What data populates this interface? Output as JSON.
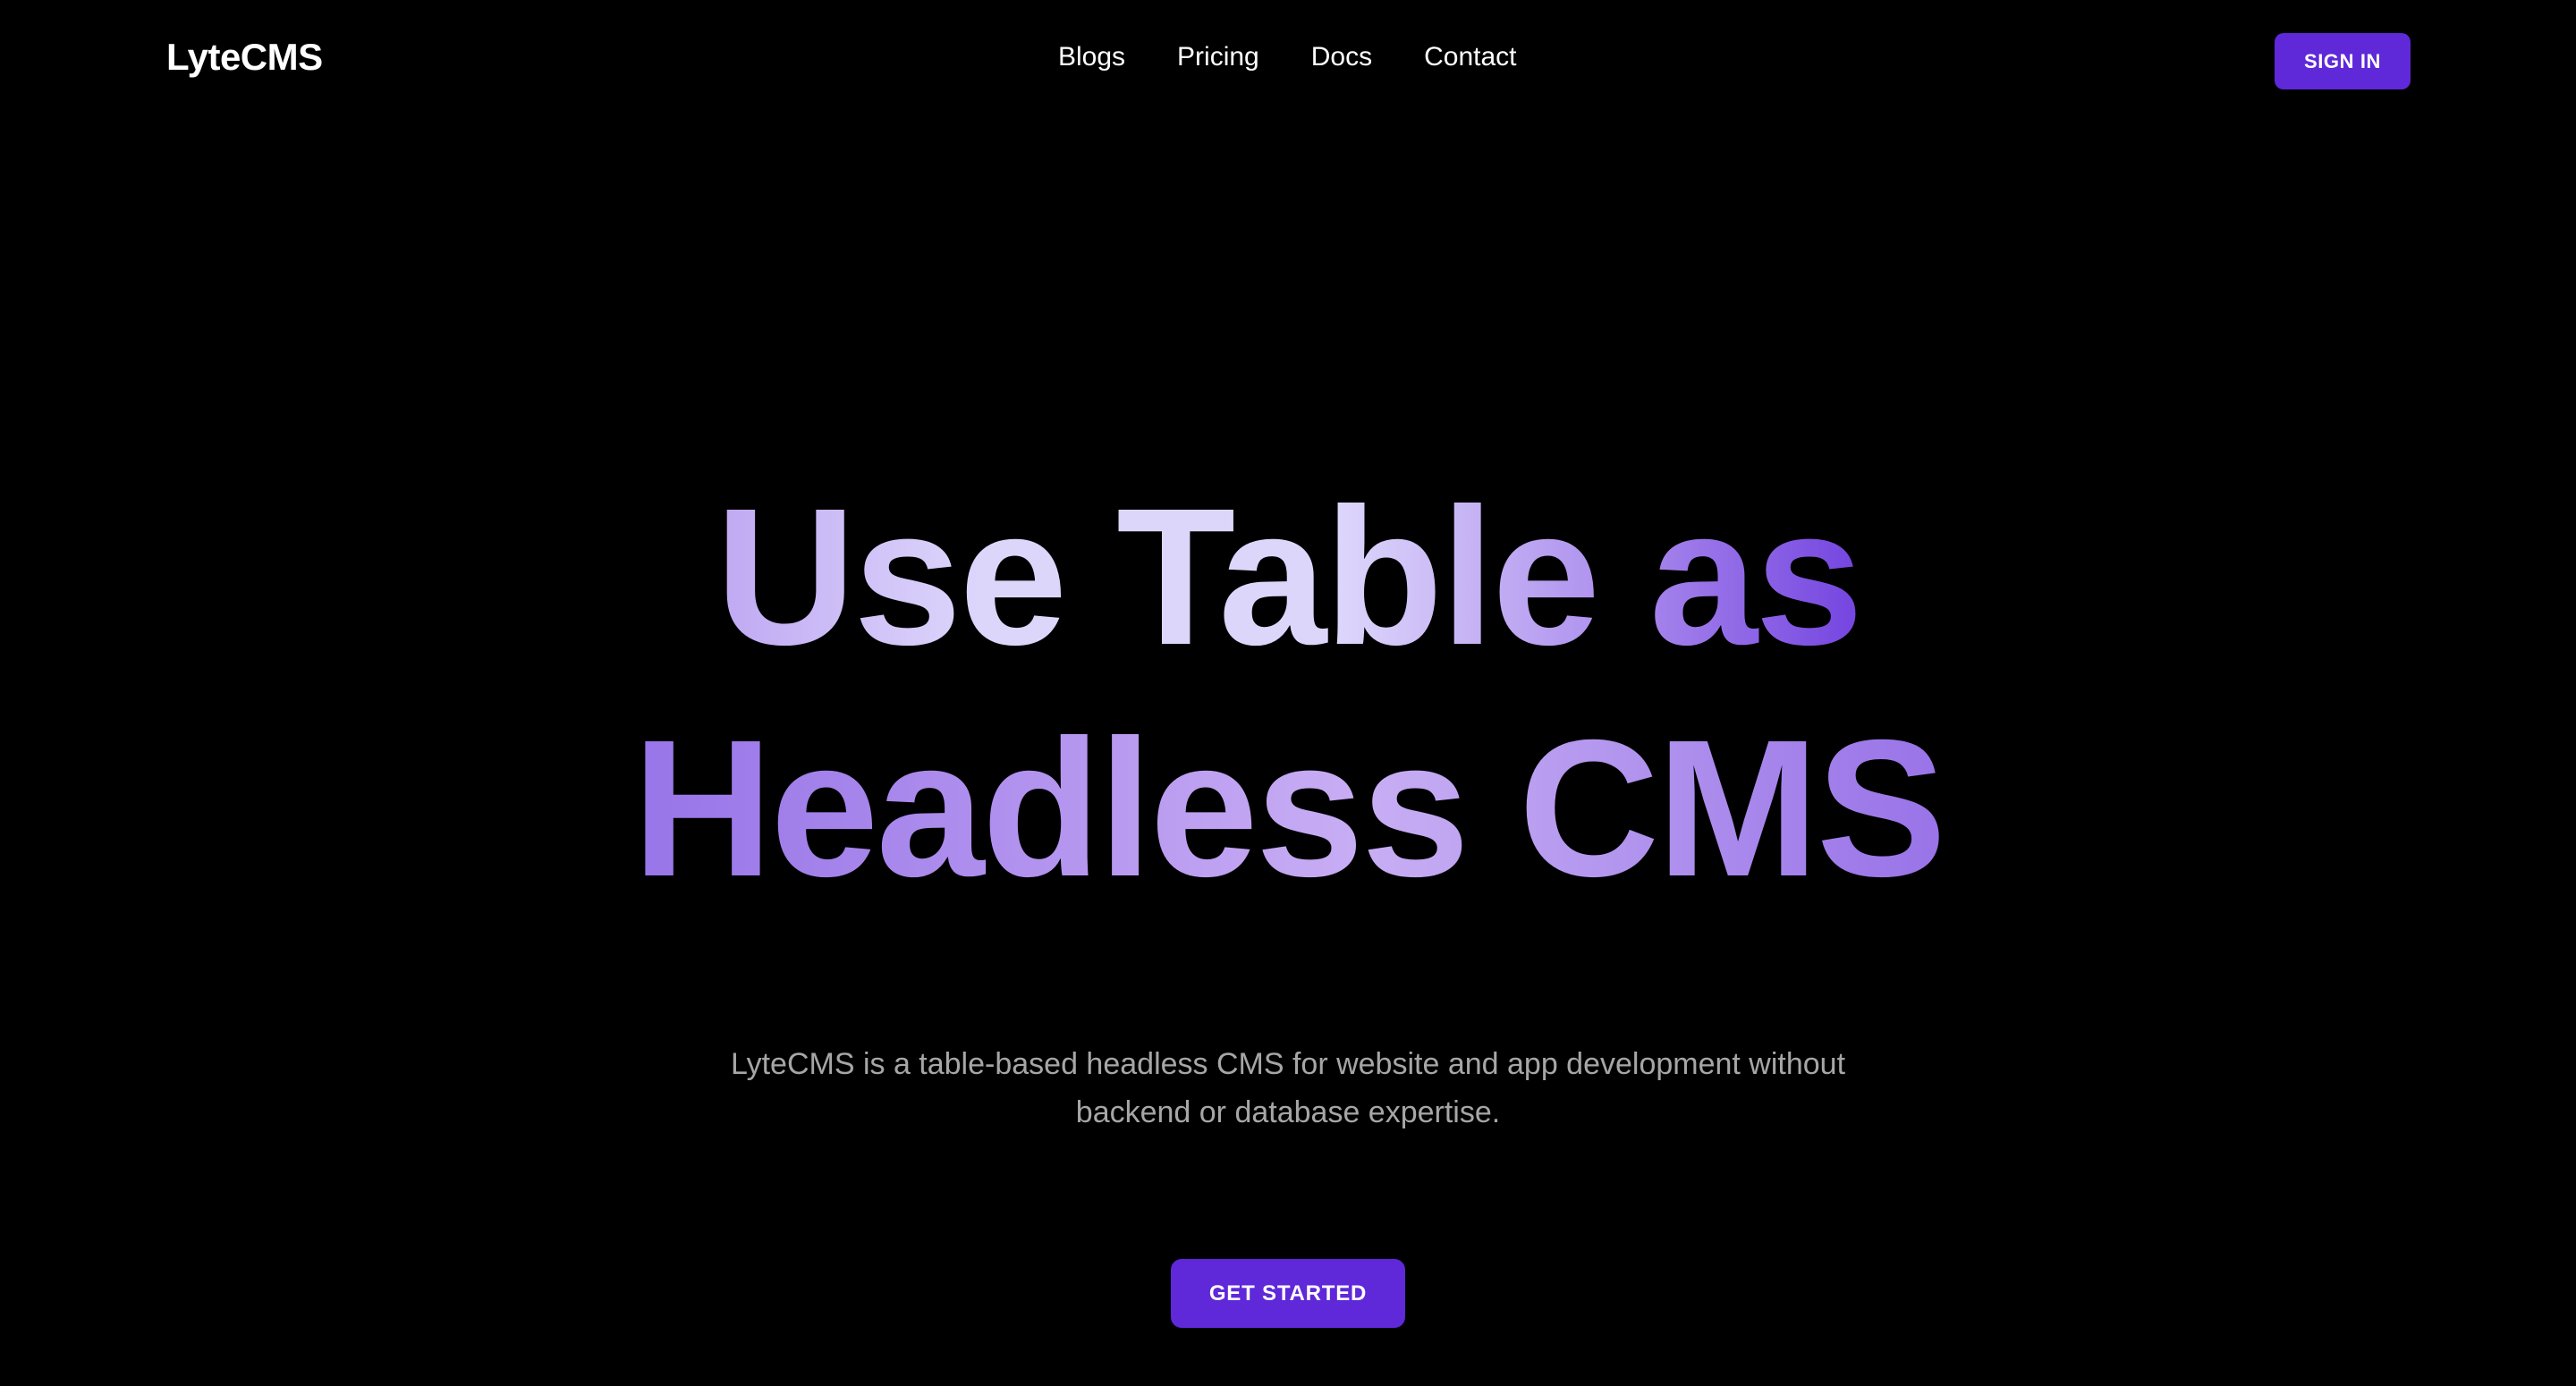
{
  "theme": {
    "background": "#000000",
    "accent": "#5f28d8",
    "heading_gradient_dark": "#6030d8",
    "heading_gradient_light": "#ddd6fb",
    "subtitle_color": "#a6a6a6",
    "nav_text_color": "#ffffff"
  },
  "header": {
    "logo": "LyteCMS",
    "nav": [
      {
        "label": "Blogs"
      },
      {
        "label": "Pricing"
      },
      {
        "label": "Docs"
      },
      {
        "label": "Contact"
      }
    ],
    "signin_label": "SIGN IN"
  },
  "hero": {
    "heading_line_1": "Use Table as",
    "heading_line_2": "Headless CMS",
    "subtitle": "LyteCMS is a table-based headless CMS for website and app development without backend or database expertise.",
    "cta_label": "GET STARTED"
  }
}
